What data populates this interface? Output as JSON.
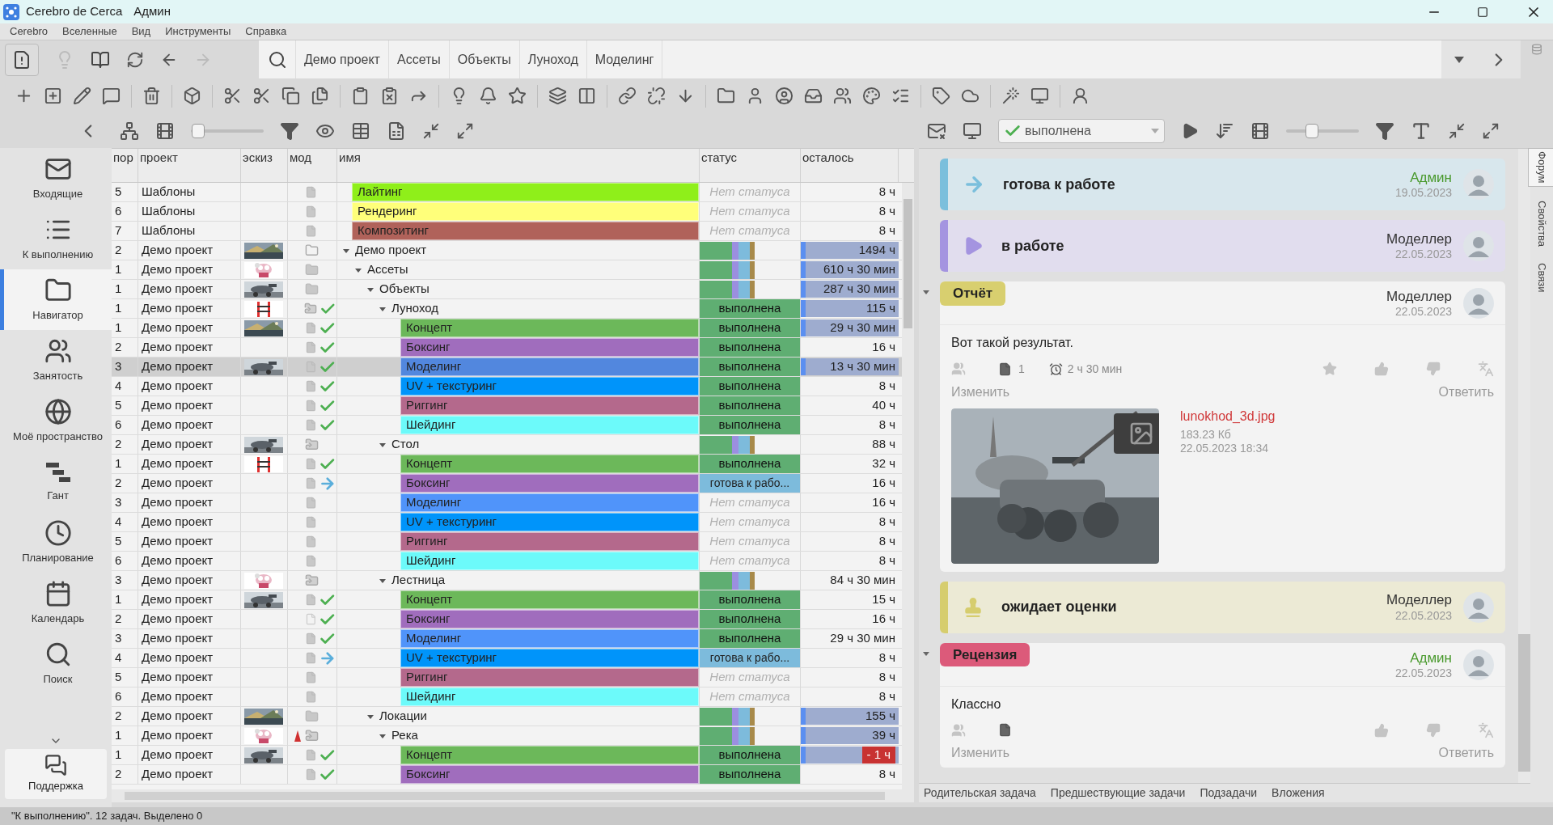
{
  "window": {
    "app": "Cerebro de Cerca",
    "user": "Админ"
  },
  "menu": [
    "Cerebro",
    "Вселенные",
    "Вид",
    "Инструменты",
    "Справка"
  ],
  "breadcrumbs": [
    "Демо проект",
    "Ассеты",
    "Объекты",
    "Луноход",
    "Моделинг"
  ],
  "left_toolbar": {
    "zoom_slider": {
      "level": 0.1
    }
  },
  "right_toolbar": {
    "status_filter": "выполнена",
    "zoom_slider": {
      "level": 0.35
    }
  },
  "sidebar": {
    "items": [
      {
        "label": "Входящие",
        "selected": false
      },
      {
        "label": "К выполнению",
        "selected": false
      },
      {
        "label": "Навигатор",
        "selected": true
      },
      {
        "label": "Занятость",
        "selected": false
      },
      {
        "label": "Моё пространство",
        "selected": false
      },
      {
        "label": "Гант",
        "selected": false
      },
      {
        "label": "Планирование",
        "selected": false
      },
      {
        "label": "Календарь",
        "selected": false
      },
      {
        "label": "Поиск",
        "selected": false
      }
    ],
    "support": "Поддержка"
  },
  "table": {
    "columns": [
      "пор",
      "проект",
      "эскиз",
      "мод",
      "имя",
      "статус",
      "осталось"
    ],
    "tree": [
      {
        "num": "5",
        "project": "Шаблоны",
        "sketch": false,
        "mod": {
          "kind": "doc"
        },
        "name": "Лайтинг",
        "color": "#8fef1a",
        "status": {
          "kind": "none",
          "text": "Нет статуса"
        },
        "remaining": "8 ч",
        "remaining_bar": false,
        "selected": false
      },
      {
        "num": "6",
        "project": "Шаблоны",
        "sketch": false,
        "mod": {
          "kind": "doc"
        },
        "name": "Рендеринг",
        "color": "#ffff7a",
        "status": {
          "kind": "none",
          "text": "Нет статуса"
        },
        "remaining": "8 ч",
        "remaining_bar": false,
        "selected": false
      },
      {
        "num": "7",
        "project": "Шаблоны",
        "sketch": false,
        "mod": {
          "kind": "doc"
        },
        "name": "Композитинг",
        "color": "#b0625a",
        "status": {
          "kind": "none",
          "text": "Нет статуса"
        },
        "remaining": "8 ч",
        "remaining_bar": false,
        "selected": false
      },
      {
        "num": "2",
        "project": "Демо проект",
        "sketch": true,
        "mod": {
          "kind": "folder-outline"
        },
        "name": "Демо проект",
        "expanded": true,
        "status": {
          "kind": "summary"
        },
        "remaining": "1494 ч",
        "remaining_bar": true,
        "selected": false,
        "children": [
          {
            "num": "1",
            "project": "Демо проект",
            "sketch": true,
            "mod": {
              "kind": "folder"
            },
            "name": "Ассеты",
            "expanded": true,
            "status": {
              "kind": "summary"
            },
            "remaining": "610 ч 30 мин",
            "remaining_bar": true,
            "selected": false,
            "children": [
              {
                "num": "1",
                "project": "Демо проект",
                "sketch": true,
                "mod": {
                  "kind": "folder"
                },
                "name": "Объекты",
                "expanded": true,
                "status": {
                  "kind": "summary"
                },
                "remaining": "287 ч 30 мин",
                "remaining_bar": true,
                "selected": false,
                "children": [
                  {
                    "num": "1",
                    "project": "Демо проект",
                    "sketch": true,
                    "mod": {
                      "kind": "folder-share"
                    },
                    "check": {
                      "kind": "done"
                    },
                    "name": "Луноход",
                    "expanded": true,
                    "status": {
                      "kind": "done",
                      "text": "выполнена"
                    },
                    "remaining": "115 ч",
                    "remaining_bar": true,
                    "selected": false,
                    "children": [
                      {
                        "num": "1",
                        "project": "Демо проект",
                        "sketch": true,
                        "mod": {
                          "kind": "doc"
                        },
                        "check": {
                          "kind": "done"
                        },
                        "name": "Концепт",
                        "color": "#6cb85a",
                        "status": {
                          "kind": "done",
                          "text": "выполнена"
                        },
                        "remaining": "29 ч 30 мин",
                        "remaining_bar": true,
                        "selected": false
                      },
                      {
                        "num": "2",
                        "project": "Демо проект",
                        "sketch": false,
                        "mod": {
                          "kind": "doc"
                        },
                        "check": {
                          "kind": "done"
                        },
                        "name": "Боксинг",
                        "color": "#a06dbd",
                        "status": {
                          "kind": "done",
                          "text": "выполнена"
                        },
                        "remaining": "16 ч",
                        "remaining_bar": false,
                        "selected": false
                      },
                      {
                        "num": "3",
                        "project": "Демо проект",
                        "sketch": true,
                        "mod": {
                          "kind": "doc"
                        },
                        "check": {
                          "kind": "done"
                        },
                        "name": "Моделинг",
                        "color": "#5287de",
                        "status": {
                          "kind": "done",
                          "text": "выполнена"
                        },
                        "remaining": "13 ч 30 мин",
                        "remaining_bar": true,
                        "selected": true
                      },
                      {
                        "num": "4",
                        "project": "Демо проект",
                        "sketch": false,
                        "mod": {
                          "kind": "doc"
                        },
                        "check": {
                          "kind": "done"
                        },
                        "name": "UV + текстуринг",
                        "color": "#0094fa",
                        "status": {
                          "kind": "done",
                          "text": "выполнена"
                        },
                        "remaining": "8 ч",
                        "remaining_bar": false,
                        "selected": false
                      },
                      {
                        "num": "5",
                        "project": "Демо проект",
                        "sketch": false,
                        "mod": {
                          "kind": "doc"
                        },
                        "check": {
                          "kind": "done"
                        },
                        "name": "Риггинг",
                        "color": "#b4698c",
                        "status": {
                          "kind": "done",
                          "text": "выполнена"
                        },
                        "remaining": "40 ч",
                        "remaining_bar": false,
                        "selected": false
                      },
                      {
                        "num": "6",
                        "project": "Демо проект",
                        "sketch": false,
                        "mod": {
                          "kind": "doc"
                        },
                        "check": {
                          "kind": "done"
                        },
                        "name": "Шейдинг",
                        "color": "#6cfafa",
                        "status": {
                          "kind": "done",
                          "text": "выполнена"
                        },
                        "remaining": "8 ч",
                        "remaining_bar": false,
                        "selected": false
                      }
                    ]
                  },
                  {
                    "num": "2",
                    "project": "Демо проект",
                    "sketch": true,
                    "mod": {
                      "kind": "folder-share"
                    },
                    "name": "Стол",
                    "expanded": true,
                    "status": {
                      "kind": "summary"
                    },
                    "remaining": "88 ч",
                    "remaining_bar": false,
                    "selected": false,
                    "children": [
                      {
                        "num": "1",
                        "project": "Демо проект",
                        "sketch": true,
                        "mod": {
                          "kind": "doc"
                        },
                        "check": {
                          "kind": "done"
                        },
                        "name": "Концепт",
                        "color": "#6cb85a",
                        "status": {
                          "kind": "done",
                          "text": "выполнена"
                        },
                        "remaining": "32 ч",
                        "remaining_bar": false,
                        "selected": false
                      },
                      {
                        "num": "2",
                        "project": "Демо проект",
                        "sketch": false,
                        "mod": {
                          "kind": "doc"
                        },
                        "check": {
                          "kind": "ready"
                        },
                        "name": "Боксинг",
                        "color": "#a06dbd",
                        "status": {
                          "kind": "ready",
                          "text": "готова к рабо..."
                        },
                        "remaining": "16 ч",
                        "remaining_bar": false,
                        "selected": false
                      },
                      {
                        "num": "3",
                        "project": "Демо проект",
                        "sketch": false,
                        "mod": {
                          "kind": "doc"
                        },
                        "name": "Моделинг",
                        "color": "#5094fa",
                        "status": {
                          "kind": "none",
                          "text": "Нет статуса"
                        },
                        "remaining": "16 ч",
                        "remaining_bar": false,
                        "selected": false
                      },
                      {
                        "num": "4",
                        "project": "Демо проект",
                        "sketch": false,
                        "mod": {
                          "kind": "doc"
                        },
                        "name": "UV + текстуринг",
                        "color": "#0094fa",
                        "status": {
                          "kind": "none",
                          "text": "Нет статуса"
                        },
                        "remaining": "8 ч",
                        "remaining_bar": false,
                        "selected": false
                      },
                      {
                        "num": "5",
                        "project": "Демо проект",
                        "sketch": false,
                        "mod": {
                          "kind": "doc"
                        },
                        "name": "Риггинг",
                        "color": "#b4698c",
                        "status": {
                          "kind": "none",
                          "text": "Нет статуса"
                        },
                        "remaining": "8 ч",
                        "remaining_bar": false,
                        "selected": false
                      },
                      {
                        "num": "6",
                        "project": "Демо проект",
                        "sketch": false,
                        "mod": {
                          "kind": "doc"
                        },
                        "name": "Шейдинг",
                        "color": "#6cfafa",
                        "status": {
                          "kind": "none",
                          "text": "Нет статуса"
                        },
                        "remaining": "8 ч",
                        "remaining_bar": false,
                        "selected": false
                      }
                    ]
                  },
                  {
                    "num": "3",
                    "project": "Демо проект",
                    "sketch": true,
                    "mod": {
                      "kind": "folder-share"
                    },
                    "name": "Лестница",
                    "expanded": true,
                    "status": {
                      "kind": "summary"
                    },
                    "remaining": "84 ч 30 мин",
                    "remaining_bar": false,
                    "selected": false,
                    "children": [
                      {
                        "num": "1",
                        "project": "Демо проект",
                        "sketch": true,
                        "mod": {
                          "kind": "doc"
                        },
                        "check": {
                          "kind": "done"
                        },
                        "name": "Концепт",
                        "color": "#6cb85a",
                        "status": {
                          "kind": "done",
                          "text": "выполнена"
                        },
                        "remaining": "15 ч",
                        "remaining_bar": false,
                        "selected": false
                      },
                      {
                        "num": "2",
                        "project": "Демо проект",
                        "sketch": false,
                        "mod": {
                          "kind": "doc-outline"
                        },
                        "check": {
                          "kind": "done"
                        },
                        "name": "Боксинг",
                        "color": "#a06dbd",
                        "status": {
                          "kind": "done",
                          "text": "выполнена"
                        },
                        "remaining": "16 ч",
                        "remaining_bar": false,
                        "selected": false
                      },
                      {
                        "num": "3",
                        "project": "Демо проект",
                        "sketch": false,
                        "mod": {
                          "kind": "doc"
                        },
                        "check": {
                          "kind": "done"
                        },
                        "name": "Моделинг",
                        "color": "#5094fa",
                        "status": {
                          "kind": "done",
                          "text": "выполнена"
                        },
                        "remaining": "29 ч 30 мин",
                        "remaining_bar": false,
                        "selected": false
                      },
                      {
                        "num": "4",
                        "project": "Демо проект",
                        "sketch": false,
                        "mod": {
                          "kind": "doc"
                        },
                        "check": {
                          "kind": "ready"
                        },
                        "name": "UV + текстуринг",
                        "color": "#0094fa",
                        "status": {
                          "kind": "ready",
                          "text": "готова к рабо..."
                        },
                        "remaining": "8 ч",
                        "remaining_bar": false,
                        "selected": false
                      },
                      {
                        "num": "5",
                        "project": "Демо проект",
                        "sketch": false,
                        "mod": {
                          "kind": "doc"
                        },
                        "name": "Риггинг",
                        "color": "#b4698c",
                        "status": {
                          "kind": "none",
                          "text": "Нет статуса"
                        },
                        "remaining": "8 ч",
                        "remaining_bar": false,
                        "selected": false
                      },
                      {
                        "num": "6",
                        "project": "Демо проект",
                        "sketch": false,
                        "mod": {
                          "kind": "doc"
                        },
                        "name": "Шейдинг",
                        "color": "#6cfafa",
                        "status": {
                          "kind": "none",
                          "text": "Нет статуса"
                        },
                        "remaining": "8 ч",
                        "remaining_bar": false,
                        "selected": false
                      }
                    ]
                  }
                ]
              },
              {
                "num": "2",
                "project": "Демо проект",
                "sketch": true,
                "mod": {
                  "kind": "folder"
                },
                "name": "Локации",
                "expanded": true,
                "status": {
                  "kind": "summary"
                },
                "remaining": "155 ч",
                "remaining_bar": true,
                "selected": false,
                "children": [
                  {
                    "num": "1",
                    "project": "Демо проект",
                    "sketch": true,
                    "mod": {
                      "kind": "folder-share"
                    },
                    "warning": true,
                    "name": "Река",
                    "expanded": true,
                    "status": {
                      "kind": "summary"
                    },
                    "remaining": "39 ч",
                    "remaining_bar": true,
                    "selected": false,
                    "children": [
                      {
                        "num": "1",
                        "project": "Демо проект",
                        "sketch": true,
                        "mod": {
                          "kind": "doc"
                        },
                        "check": {
                          "kind": "done"
                        },
                        "name": "Концепт",
                        "color": "#6cb85a",
                        "status": {
                          "kind": "done",
                          "text": "выполнена"
                        },
                        "remaining": "- 1 ч",
                        "remaining_bar": true,
                        "overdue": true,
                        "selected": false
                      },
                      {
                        "num": "2",
                        "project": "Демо проект",
                        "sketch": false,
                        "mod": {
                          "kind": "doc"
                        },
                        "check": {
                          "kind": "done"
                        },
                        "name": "Боксинг",
                        "color": "#a06dbd",
                        "status": {
                          "kind": "done",
                          "text": "выполнена"
                        },
                        "remaining": "8 ч",
                        "remaining_bar": false,
                        "selected": false
                      }
                    ]
                  }
                ]
              }
            ]
          }
        ]
      }
    ]
  },
  "feed": [
    {
      "kind": "status",
      "event": {
        "kind": "ready"
      },
      "title": "готова к работе",
      "color": "#7bbfdc",
      "author": {
        "name": "Админ",
        "color": "#4a9a2e"
      },
      "date": "19.05.2023"
    },
    {
      "kind": "status",
      "event": {
        "kind": "in_progress"
      },
      "title": "в работе",
      "color": "#a494e0",
      "author": {
        "name": "Моделлер",
        "color": "#333333"
      },
      "date": "22.05.2023"
    },
    {
      "kind": "comment",
      "tag": "Отчёт",
      "color": "#d8cf6f",
      "expanded": true,
      "author": {
        "name": "Моделлер",
        "color": "#333333"
      },
      "date": "22.05.2023",
      "text": "Вот такой результат.",
      "attachments": "1",
      "time": "2 ч 30 мин",
      "rating_enabled": true,
      "edit": "Изменить",
      "reply": "Ответить",
      "attachment": {
        "file": "lunokhod_3d.jpg",
        "size": "183.23 Кб",
        "date": "22.05.2023 18:34"
      }
    },
    {
      "kind": "status",
      "event": {
        "kind": "awaiting_review"
      },
      "title": "ожидает оценки",
      "color": "#d6cd6e",
      "author": {
        "name": "Моделлер",
        "color": "#333333"
      },
      "date": "22.05.2023"
    },
    {
      "kind": "comment",
      "tag": "Рецензия",
      "color": "#dc5a7a",
      "expanded": true,
      "author": {
        "name": "Админ",
        "color": "#4a9a2e"
      },
      "date": "22.05.2023",
      "text": "Классно",
      "rating_enabled": false,
      "edit": "Изменить",
      "reply": "Ответить"
    }
  ],
  "bottom_tabs": [
    "Родительская задача",
    "Предшествующие задачи",
    "Подзадачи",
    "Вложения"
  ],
  "side_tabs": [
    {
      "label": "Форум",
      "selected": true
    },
    {
      "label": "Свойства",
      "selected": false
    },
    {
      "label": "Связи",
      "selected": false
    }
  ],
  "status_bar": "\"К выполнению\". 12 задач. Выделено 0"
}
